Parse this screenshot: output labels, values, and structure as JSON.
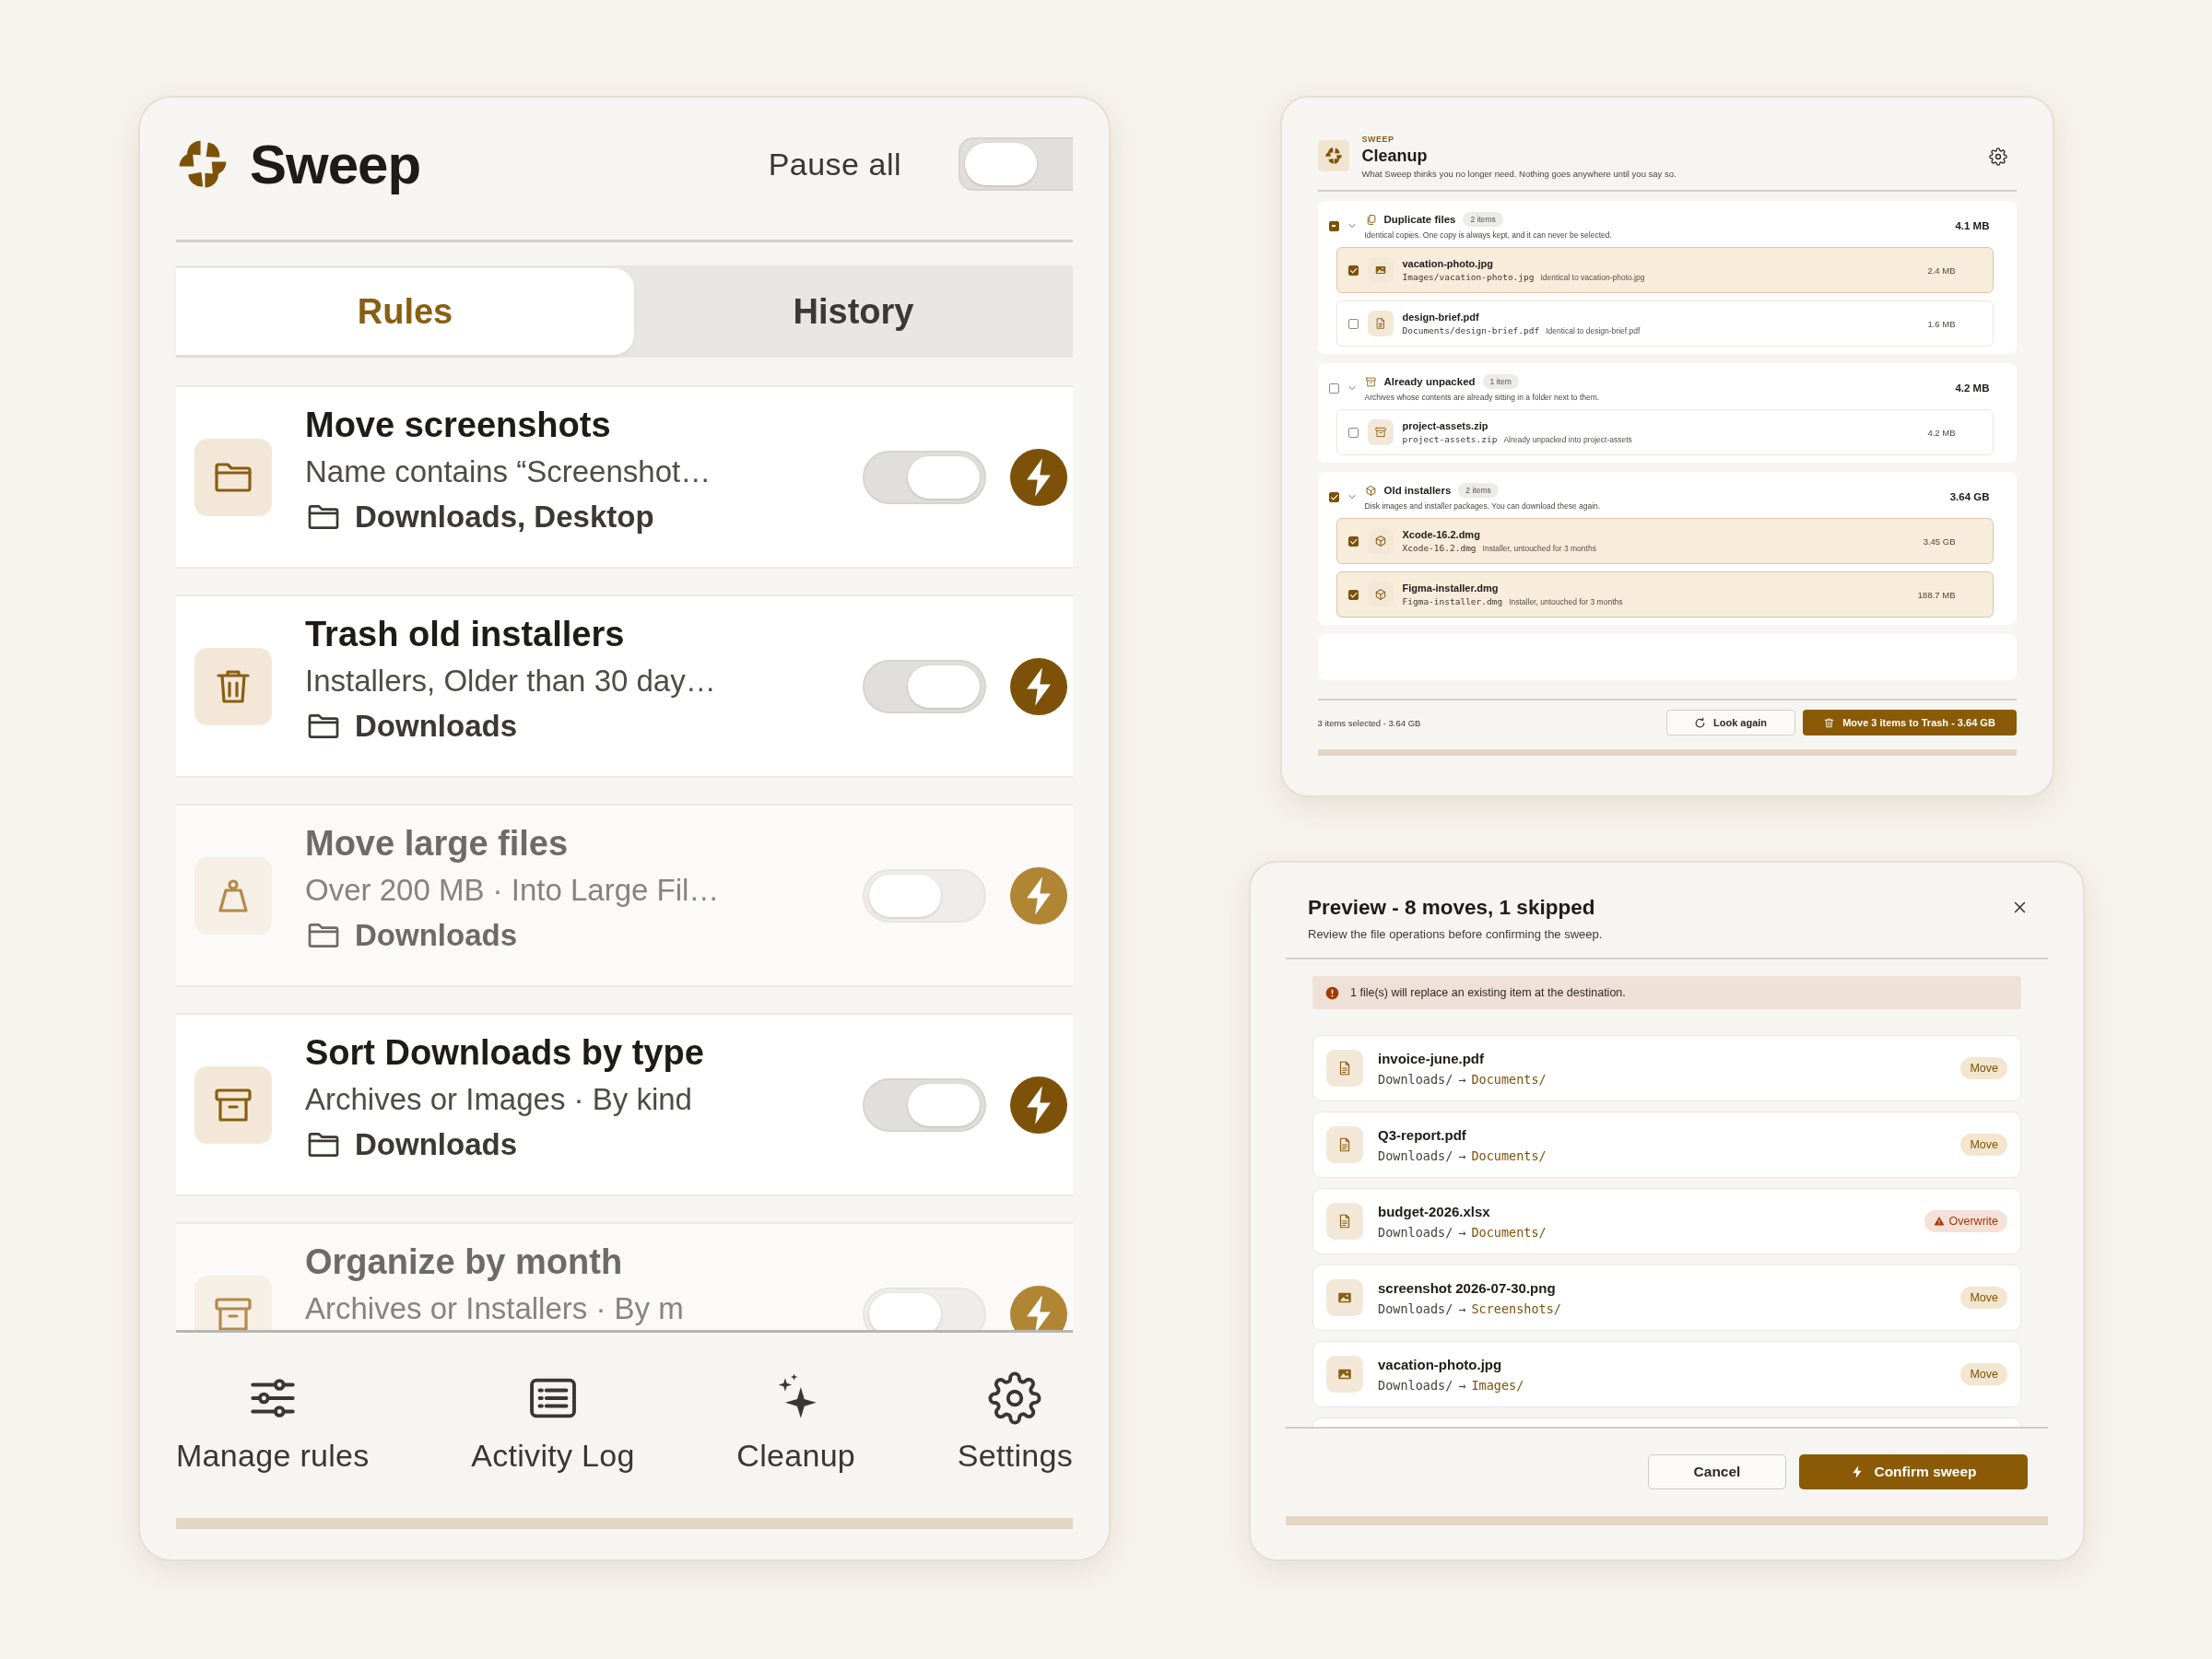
{
  "main_window": {
    "app_name": "Sweep",
    "pause_all": {
      "label": "Pause all",
      "on": false
    },
    "tabs": [
      {
        "label": "Rules",
        "selected": true
      },
      {
        "label": "History",
        "selected": false
      }
    ],
    "rules": [
      {
        "kind": "move",
        "title": "Move screenshots",
        "summary": "Name contains “Screenshot…",
        "folders": "Downloads, Desktop",
        "on": true
      },
      {
        "kind": "trash",
        "title": "Trash old installers",
        "summary": "Installers, Older than 30 day…",
        "folders": "Downloads",
        "on": true
      },
      {
        "kind": "size",
        "title": "Move large files",
        "summary": "Over 200 MB · Into Large Fil…",
        "folders": "Downloads",
        "on": false
      },
      {
        "kind": "sort",
        "title": "Sort Downloads by type",
        "summary": "Archives or Images · By kind",
        "folders": "Downloads",
        "on": true
      },
      {
        "kind": "sort",
        "title": "Organize by month",
        "summary": "Archives or Installers · By m",
        "on": false
      }
    ],
    "nav": [
      {
        "label": "Manage rules"
      },
      {
        "label": "Activity Log"
      },
      {
        "label": "Cleanup"
      },
      {
        "label": "Settings"
      }
    ]
  },
  "cleanup_window": {
    "brand": "SWEEP",
    "title": "Cleanup",
    "subtitle": "What Sweep thinks you no longer need. Nothing goes anywhere until you say so.",
    "groups": [
      {
        "kind": "duplicates",
        "title": "Duplicate files",
        "count": "2 items",
        "description": "Identical copies. One copy is always kept, and it can never be selected.",
        "size": "4.1 MB",
        "partial": true,
        "expanded": true,
        "items": [
          {
            "kind": "image",
            "name": "vacation-photo.jpg",
            "path": "Images/vacation-photo.jpg",
            "note": "Identical to vacation-photo.jpg",
            "size": "2.4 MB",
            "checked": true
          },
          {
            "kind": "document",
            "name": "design-brief.pdf",
            "path": "Documents/design-brief.pdf",
            "note": "Identical to design-brief.pdf",
            "size": "1.6 MB",
            "checked": false
          }
        ]
      },
      {
        "kind": "archive",
        "title": "Already unpacked",
        "count": "1 item",
        "description": "Archives whose contents are already sitting in a folder next to them.",
        "size": "4.2 MB",
        "checked": false,
        "expanded": true,
        "items": [
          {
            "kind": "archive",
            "name": "project-assets.zip",
            "path": "project-assets.zip",
            "note": "Already unpacked into project-assets",
            "size": "4.2 MB",
            "checked": false
          }
        ]
      },
      {
        "kind": "installer",
        "title": "Old installers",
        "count": "2 items",
        "description": "Disk images and installer packages. You can download these again.",
        "size": "3.64 GB",
        "checked": true,
        "expanded": true,
        "items": [
          {
            "kind": "installer",
            "name": "Xcode-16.2.dmg",
            "path": "Xcode-16.2.dmg",
            "note": "Installer, untouched for 3 months",
            "size": "3.45 GB",
            "checked": true
          },
          {
            "kind": "installer",
            "name": "Figma-installer.dmg",
            "path": "Figma-installer.dmg",
            "note": "Installer, untouched for 3 months",
            "size": "188.7 MB",
            "checked": true
          }
        ]
      }
    ],
    "selection_summary": "3 items selected - 3.64 GB",
    "buttons": [
      {
        "kind": "secondary",
        "label": "Look again"
      },
      {
        "kind": "primary",
        "label": "Move 3 items to Trash - 3.64 GB"
      }
    ]
  },
  "preview_dialog": {
    "title": "Preview - 8 moves, 1 skipped",
    "subtitle": "Review the file operations before confirming the sweep.",
    "warning": "1 file(s) will replace an existing item at the destination.",
    "operations": [
      {
        "kind": "document",
        "name": "invoice-june.pdf",
        "source": "Downloads/",
        "arrow": "→",
        "destination": "Documents/",
        "overwrite": false,
        "badge": "Move"
      },
      {
        "kind": "document",
        "name": "Q3-report.pdf",
        "source": "Downloads/",
        "arrow": "→",
        "destination": "Documents/",
        "overwrite": false,
        "badge": "Move"
      },
      {
        "kind": "document",
        "name": "budget-2026.xlsx",
        "source": "Downloads/",
        "arrow": "→",
        "destination": "Documents/",
        "overwrite": true,
        "badge": "Overwrite"
      },
      {
        "kind": "image",
        "name": "screenshot 2026-07-30.png",
        "source": "Downloads/",
        "arrow": "→",
        "destination": "Screenshots/",
        "overwrite": false,
        "badge": "Move"
      },
      {
        "kind": "image",
        "name": "vacation-photo.jpg",
        "source": "Downloads/",
        "arrow": "→",
        "destination": "Images/",
        "overwrite": false,
        "badge": "Move"
      }
    ],
    "buttons": [
      {
        "kind": "secondary",
        "label": "Cancel"
      },
      {
        "kind": "primary",
        "label": "Confirm sweep"
      }
    ]
  }
}
